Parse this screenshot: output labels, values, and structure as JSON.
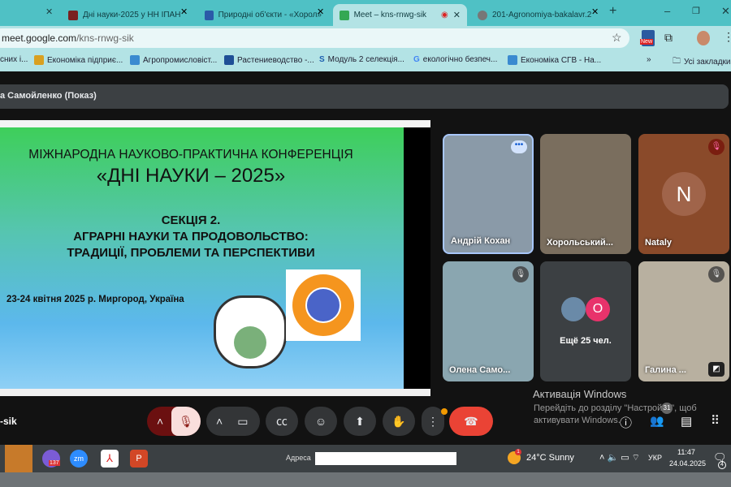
{
  "browser": {
    "tabs": [
      {
        "label": "Дні науки-2025 у НН ІПАН",
        "active": false
      },
      {
        "label": "Природні об'єкти - «Хорол»",
        "active": false
      },
      {
        "label": "Meet – kns-rnwg-sik",
        "active": true
      },
      {
        "label": "201-Agronomiya-bakalavr.2",
        "active": false
      }
    ],
    "new_tab": "+",
    "url_host": "meet.google.com",
    "url_path": "/kns-rnwg-sik",
    "extension_badge": "New",
    "bookmarks": [
      "сних і...",
      "Економіка підприє...",
      "Агропромисловіст...",
      "Растениеводство -...",
      "Модуль 2 селекція...",
      "екологічно безпеч...",
      "Економіка СГВ - На..."
    ],
    "more_bookmarks": "»",
    "all_bookmarks": "Усі закладки"
  },
  "meet": {
    "presenter_label": "а Самойленко (Показ)",
    "slide": {
      "line1": "МІЖНАРОДНА НАУКОВО-ПРАКТИЧНА КОНФЕРЕНЦІЯ",
      "line2": "«ДНІ НАУКИ – 2025»",
      "section": "СЕКЦІЯ 2.",
      "topic1": "АГРАРНІ НАУКИ ТА ПРОДОВОЛЬСТВО:",
      "topic2": "ТРАДИЦІЇ, ПРОБЛЕМИ ТА ПЕРСПЕКТИВИ",
      "date_place": "23-24 квітня 2025 р. Миргород, Україна"
    },
    "participants": [
      {
        "name": "Андрій Кохан",
        "muted": false,
        "color": "#8a9aa8"
      },
      {
        "name": "Хорольський...",
        "muted": false,
        "color": "#7a6e5e"
      },
      {
        "name": "Nataly",
        "muted": true,
        "initial": "N",
        "color": "#8a4a2a"
      },
      {
        "name": "Олена Само...",
        "muted": true,
        "color": "#8aa6b0"
      },
      {
        "name": "Галина ...",
        "muted": true,
        "color": "#b8b0a0"
      }
    ],
    "others": {
      "label": "Ещё 25 чел.",
      "avatar_initial": "O",
      "avatar_color": "#e8336b"
    },
    "meeting_code": "-sik",
    "people_count": "31",
    "end_call_color": "#ea4335",
    "watermark_title": "Активація Windows",
    "watermark_text1": "Перейдіть до розділу \"Настройки\", щоб",
    "watermark_text2": "активувати Windows."
  },
  "taskbar": {
    "address_label": "Адреса",
    "viber_badge": "137",
    "weather": "24°C  Sunny",
    "weather_badge": "1",
    "language": "УКР",
    "time": "11:47",
    "date": "24.04.2025",
    "notifications": "4"
  }
}
